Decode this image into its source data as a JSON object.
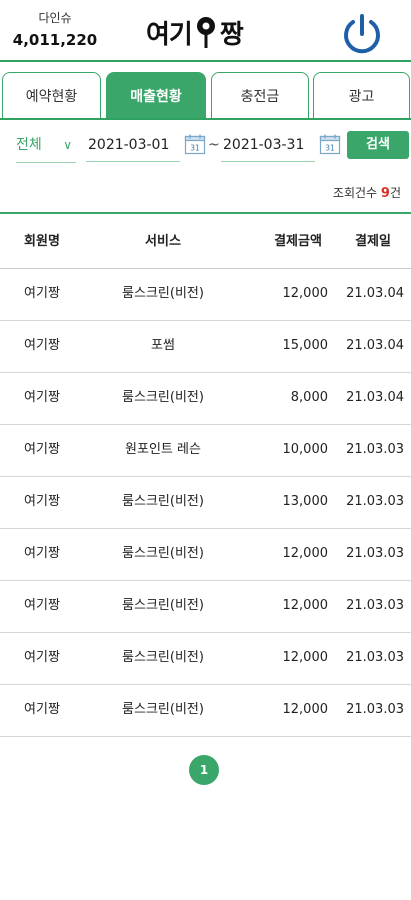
{
  "header": {
    "user_name": "다인슈",
    "points": "4,011,220",
    "logo_left": "여기",
    "logo_right": "짱"
  },
  "tabs": [
    {
      "label": "예약현황",
      "active": false
    },
    {
      "label": "매출현황",
      "active": true
    },
    {
      "label": "충전금",
      "active": false
    },
    {
      "label": "광고",
      "active": false
    }
  ],
  "filter": {
    "category": "전체",
    "start_date": "2021-03-01",
    "end_date": "2021-03-31",
    "separator": "~",
    "search_label": "검색"
  },
  "result": {
    "label": "조회건수",
    "count": "9",
    "unit": "건"
  },
  "table": {
    "columns": [
      "회원명",
      "서비스",
      "결제금액",
      "결제일"
    ],
    "rows": [
      [
        "여기짱",
        "룸스크린(비전)",
        "12,000",
        "21.03.04"
      ],
      [
        "여기짱",
        "포썸",
        "15,000",
        "21.03.04"
      ],
      [
        "여기짱",
        "룸스크린(비전)",
        "8,000",
        "21.03.04"
      ],
      [
        "여기짱",
        "원포인트 레슨",
        "10,000",
        "21.03.03"
      ],
      [
        "여기짱",
        "룸스크린(비전)",
        "13,000",
        "21.03.03"
      ],
      [
        "여기짱",
        "룸스크린(비전)",
        "12,000",
        "21.03.03"
      ],
      [
        "여기짱",
        "룸스크린(비전)",
        "12,000",
        "21.03.03"
      ],
      [
        "여기짱",
        "룸스크린(비전)",
        "12,000",
        "21.03.03"
      ],
      [
        "여기짱",
        "룸스크린(비전)",
        "12,000",
        "21.03.03"
      ]
    ]
  },
  "pagination": {
    "current": "1"
  },
  "colors": {
    "accent": "#3aa66a",
    "highlight": "#d9322a",
    "power_icon": "#1f5fa8"
  }
}
